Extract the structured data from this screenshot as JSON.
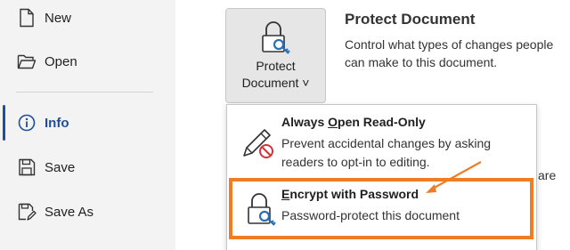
{
  "nav": {
    "items": [
      {
        "label": "New",
        "icon": "new-document-icon"
      },
      {
        "label": "Open",
        "icon": "open-folder-icon"
      },
      {
        "label": "Info",
        "icon": "info-icon",
        "active": true
      },
      {
        "label": "Save",
        "icon": "save-icon"
      },
      {
        "label": "Save As",
        "icon": "save-as-icon"
      }
    ]
  },
  "protect_button": {
    "line1": "Protect",
    "line2": "Document ˅",
    "icon": "lock-key-icon"
  },
  "section": {
    "title": "Protect Document",
    "description": "Control what types of changes people can make to this document.",
    "behind_text": "are"
  },
  "menu": {
    "items": [
      {
        "title_pre": "Always ",
        "title_underlined": "O",
        "title_post": "pen Read-Only",
        "description": "Prevent accidental changes by asking readers to opt-in to editing.",
        "icon": "pencil-no-edit-icon"
      },
      {
        "title_underlined": "E",
        "title_post": "ncrypt with Password",
        "description": "Password-protect this document",
        "icon": "lock-key-icon"
      }
    ]
  },
  "colors": {
    "accent": "#1f4e9c",
    "highlight": "#f07d24",
    "nav_background": "#f3f3f3",
    "button_background": "#e6e6e6"
  }
}
